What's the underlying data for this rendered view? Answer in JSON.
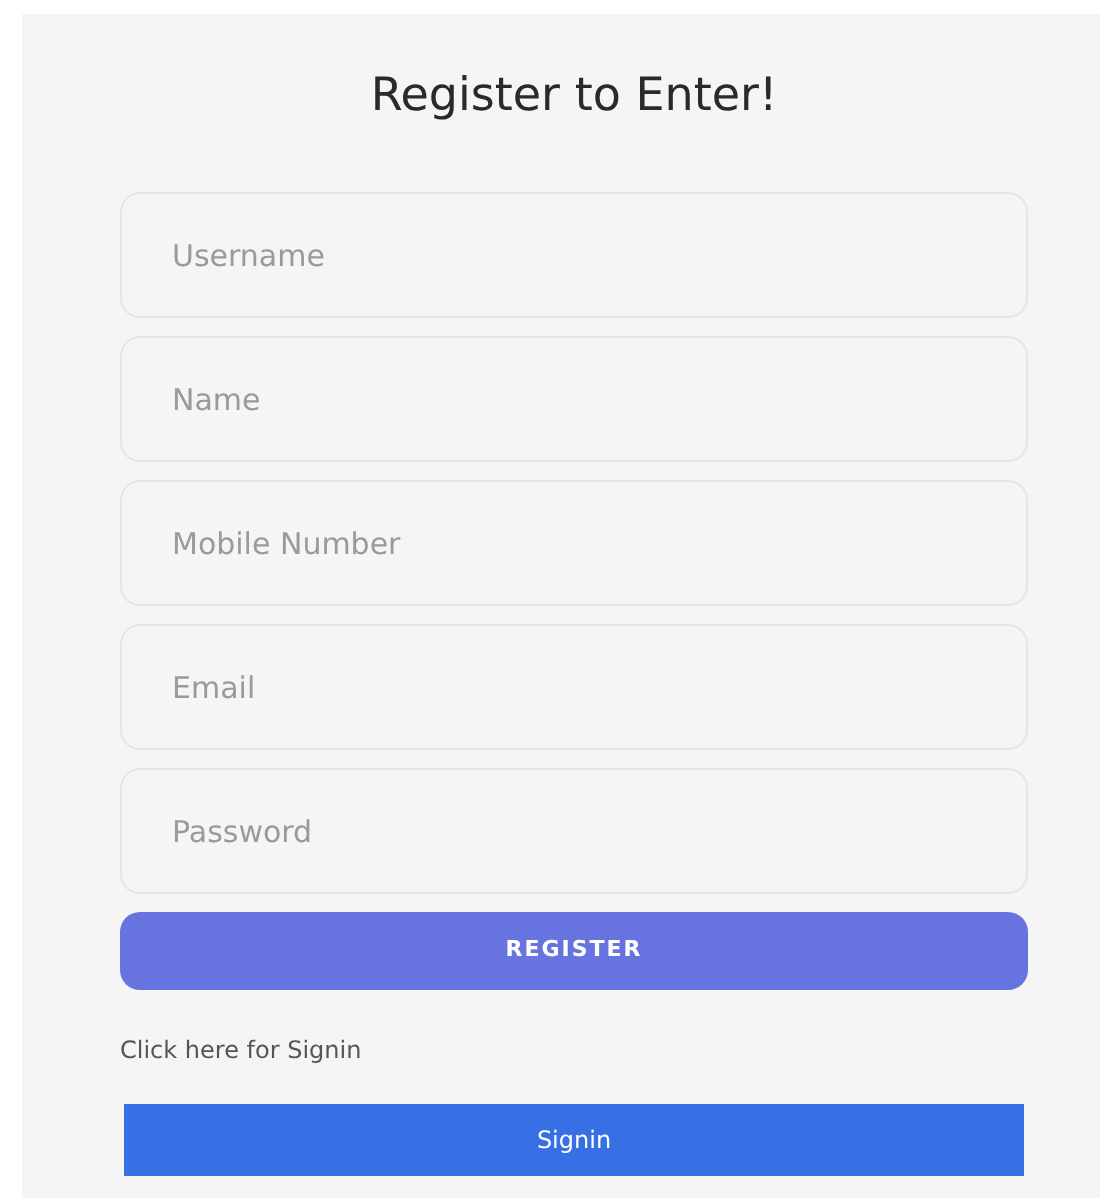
{
  "title": "Register to Enter!",
  "fields": [
    {
      "placeholder": "Username"
    },
    {
      "placeholder": "Name"
    },
    {
      "placeholder": "Mobile Number"
    },
    {
      "placeholder": "Email"
    },
    {
      "placeholder": "Password"
    }
  ],
  "register_button": "REGISTER",
  "signin_prompt": "Click here for Signin",
  "signin_button": "Signin"
}
